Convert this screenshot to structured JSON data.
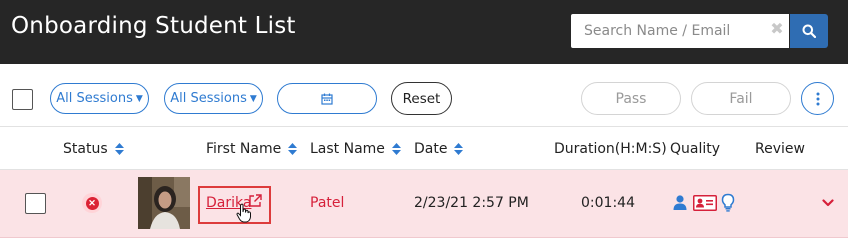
{
  "header": {
    "title": "Onboarding Student List",
    "search_placeholder": "Search Name / Email",
    "clear_symbol": "✖"
  },
  "toolbar": {
    "session_filter_1": "All Sessions",
    "session_filter_2": "All Sessions",
    "date_filter_icon": "calendar-icon",
    "reset_label": "Reset",
    "pass_label": "Pass",
    "fail_label": "Fail",
    "more_icon": "kebab-vertical-icon"
  },
  "table": {
    "columns": {
      "status": "Status",
      "first_name": "First Name",
      "last_name": "Last Name",
      "date": "Date",
      "duration": "Duration(H:M:S)",
      "quality": "Quality",
      "review": "Review"
    },
    "rows": [
      {
        "status": "failed",
        "first_name": "Darika",
        "last_name": "Patel",
        "date": "2/23/21 2:57 PM",
        "duration": "0:01:44",
        "quality_icons": [
          "person-icon",
          "id-card-icon",
          "lightbulb-icon"
        ],
        "expand_icon": "chevron-down-icon"
      }
    ]
  },
  "colors": {
    "header_bg": "#262626",
    "accent_blue": "#2f7bd1",
    "error_red": "#d6203a",
    "row_highlight": "#fbe3e6"
  }
}
